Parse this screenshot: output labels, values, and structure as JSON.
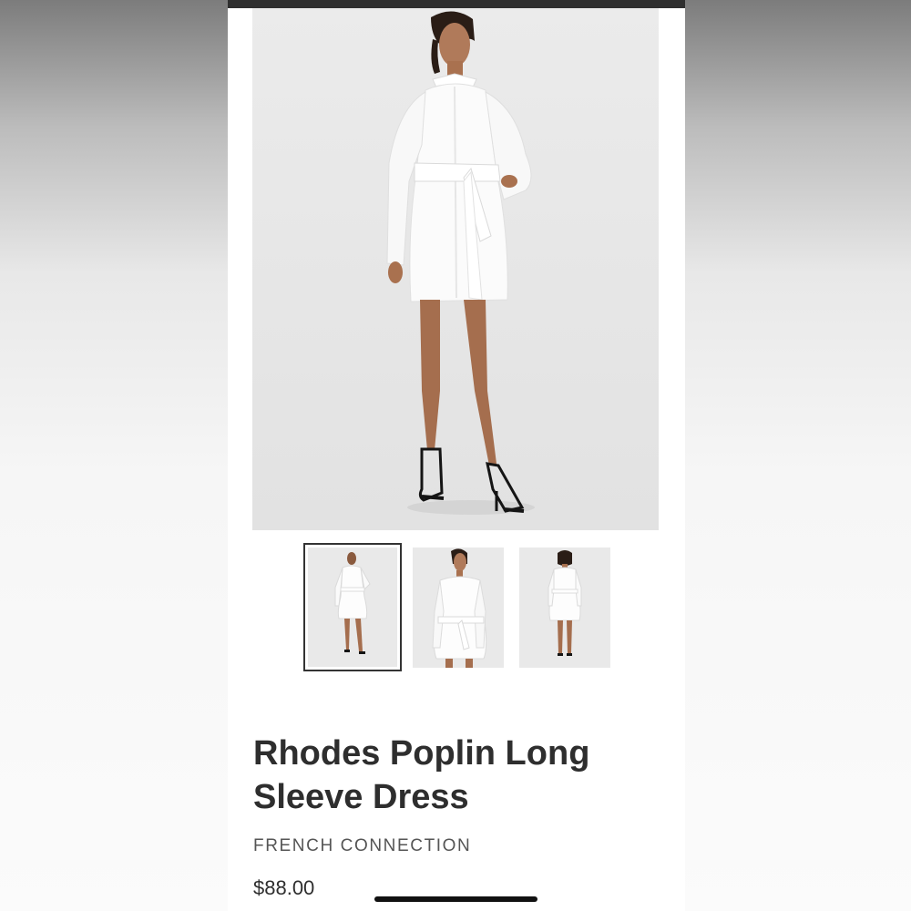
{
  "product": {
    "title": "Rhodes Poplin Long Sleeve Dress",
    "brand": "FRENCH CONNECTION",
    "price": "$88.00"
  },
  "gallery": {
    "main_image": "model-white-shirt-dress-front",
    "thumbnails": [
      {
        "name": "model-front-full",
        "selected": true
      },
      {
        "name": "model-front-closeup",
        "selected": false
      },
      {
        "name": "model-back-full",
        "selected": false
      }
    ]
  },
  "colors": {
    "text_primary": "#2e2e2e",
    "text_secondary": "#555555",
    "image_background": "#e9e9e9",
    "selected_border": "#333333"
  }
}
